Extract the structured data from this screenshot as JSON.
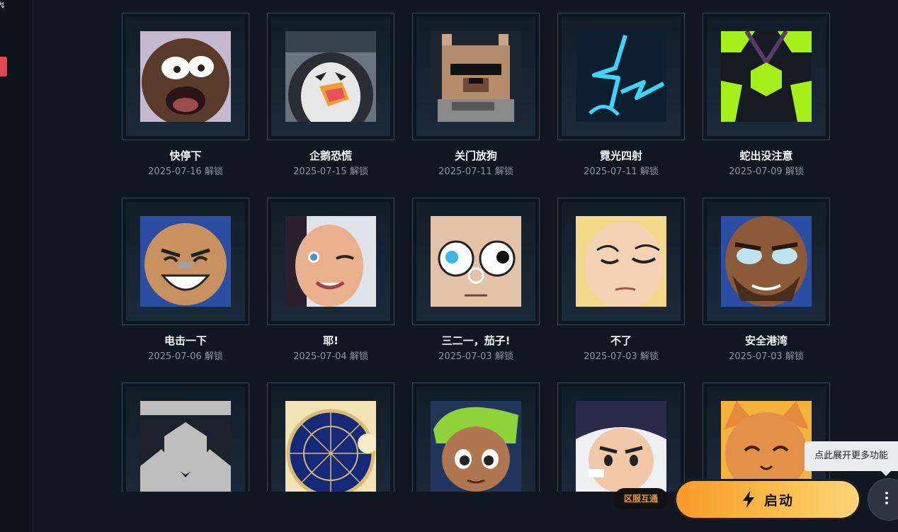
{
  "sidebar": {
    "glyph": "↯"
  },
  "emotes": [
    {
      "name": "快停下",
      "date": "2025-07-16 解锁",
      "icon": "shocked-face-icon"
    },
    {
      "name": "企鹅恐慌",
      "date": "2025-07-15 解锁",
      "icon": "penguin-icon"
    },
    {
      "name": "关门放狗",
      "date": "2025-07-11 解锁",
      "icon": "pixel-dog-icon"
    },
    {
      "name": "霓光四射",
      "date": "2025-07-11 解锁",
      "icon": "neon-sparkle-icon"
    },
    {
      "name": "蛇出没注意",
      "date": "2025-07-09 解锁",
      "icon": "green-hexagon-icon"
    },
    {
      "name": "电击一下",
      "date": "2025-07-06 解锁",
      "icon": "grinning-agent-icon"
    },
    {
      "name": "耶!",
      "date": "2025-07-04 解锁",
      "icon": "winking-agent-icon"
    },
    {
      "name": "三二一，茄子!",
      "date": "2025-07-03 解锁",
      "icon": "big-eyes-face-icon"
    },
    {
      "name": "不了",
      "date": "2025-07-03 解锁",
      "icon": "sleepy-blond-icon"
    },
    {
      "name": "安全港湾",
      "date": "2025-07-03 解锁",
      "icon": "bearded-agent-icon"
    },
    {
      "name": "",
      "date": "",
      "icon": "gray-hexagon-icon"
    },
    {
      "name": "",
      "date": "",
      "icon": "star-chart-icon"
    },
    {
      "name": "",
      "date": "",
      "icon": "green-hair-kid-icon"
    },
    {
      "name": "",
      "date": "",
      "icon": "dark-hair-agent-icon"
    },
    {
      "name": "",
      "date": "",
      "icon": "orange-cat-icon"
    }
  ],
  "tooltip": "点此展开更多功能",
  "region_badge": "区服互通",
  "launch_button": {
    "label": "启动",
    "icon": "lightning-icon"
  },
  "more_button": {
    "icon": "more-vertical-icon"
  },
  "colors": {
    "accent": "#f79a2a",
    "background": "#0f1720",
    "frame_border": "#3a4756"
  }
}
